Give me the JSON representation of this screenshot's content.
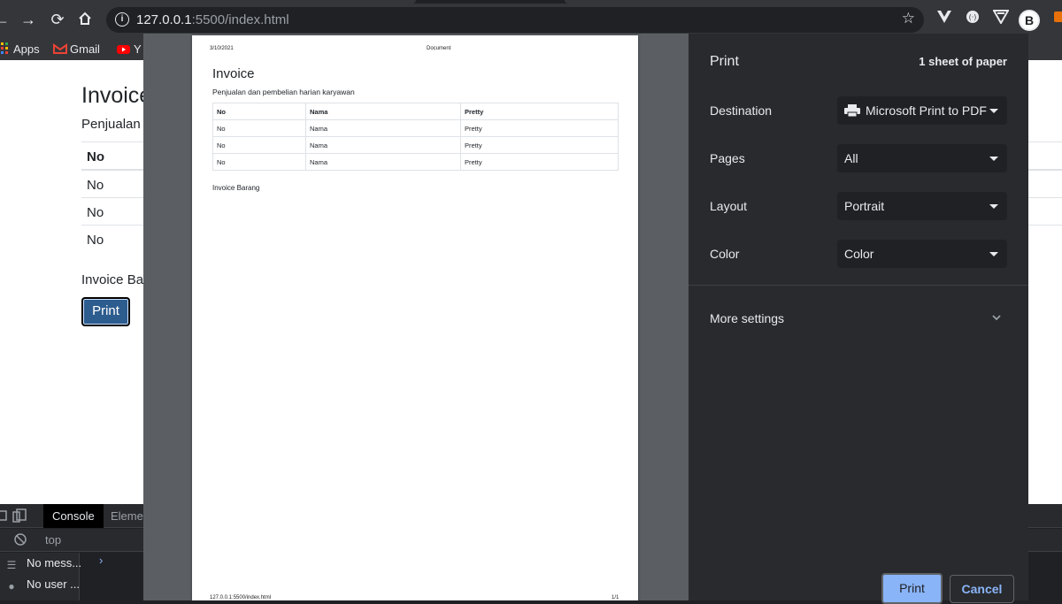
{
  "browser": {
    "url_host": "127.0.0.1",
    "url_rest": ":5500/index.html",
    "avatar_letter": "B",
    "bookmarks": [
      {
        "label": "Apps",
        "icon": "apps-grid-icon"
      },
      {
        "label": "Gmail",
        "icon": "gmail-icon"
      },
      {
        "label": "Y",
        "icon": "youtube-icon"
      }
    ]
  },
  "page": {
    "title": "Invoice",
    "subtitle": "Penjualan d",
    "table_header": "No",
    "rows": [
      "No",
      "No",
      "No"
    ],
    "footer_text": "Invoice Bar",
    "print_button": "Print"
  },
  "devtools": {
    "tabs": [
      "Console",
      "Elemen"
    ],
    "context": "top",
    "sidebar": [
      {
        "label": "No mess...",
        "icon": "list-icon"
      },
      {
        "label": "No user ...",
        "icon": "user-icon"
      }
    ],
    "prompt": "›"
  },
  "preview": {
    "header_date": "3/10/2021",
    "header_title": "Document",
    "title": "Invoice",
    "subtitle": "Penjualan dan pembelian harian karyawan",
    "columns": [
      "No",
      "Nama",
      "Pretty"
    ],
    "rows": [
      [
        "No",
        "Nama",
        "Pretty"
      ],
      [
        "No",
        "Nama",
        "Pretty"
      ],
      [
        "No",
        "Nama",
        "Pretty"
      ]
    ],
    "footer_text": "Invoice Barang",
    "footer_url": "127.0.0.1:5500/index.html",
    "page_number": "1/1"
  },
  "print_settings": {
    "title": "Print",
    "sheets": "1 sheet of paper",
    "destination_label": "Destination",
    "destination_value": "Microsoft Print to PDF",
    "pages_label": "Pages",
    "pages_value": "All",
    "layout_label": "Layout",
    "layout_value": "Portrait",
    "color_label": "Color",
    "color_value": "Color",
    "more_settings": "More settings",
    "print_button": "Print",
    "cancel_button": "Cancel",
    "accent_color": "#8ab4f8"
  }
}
